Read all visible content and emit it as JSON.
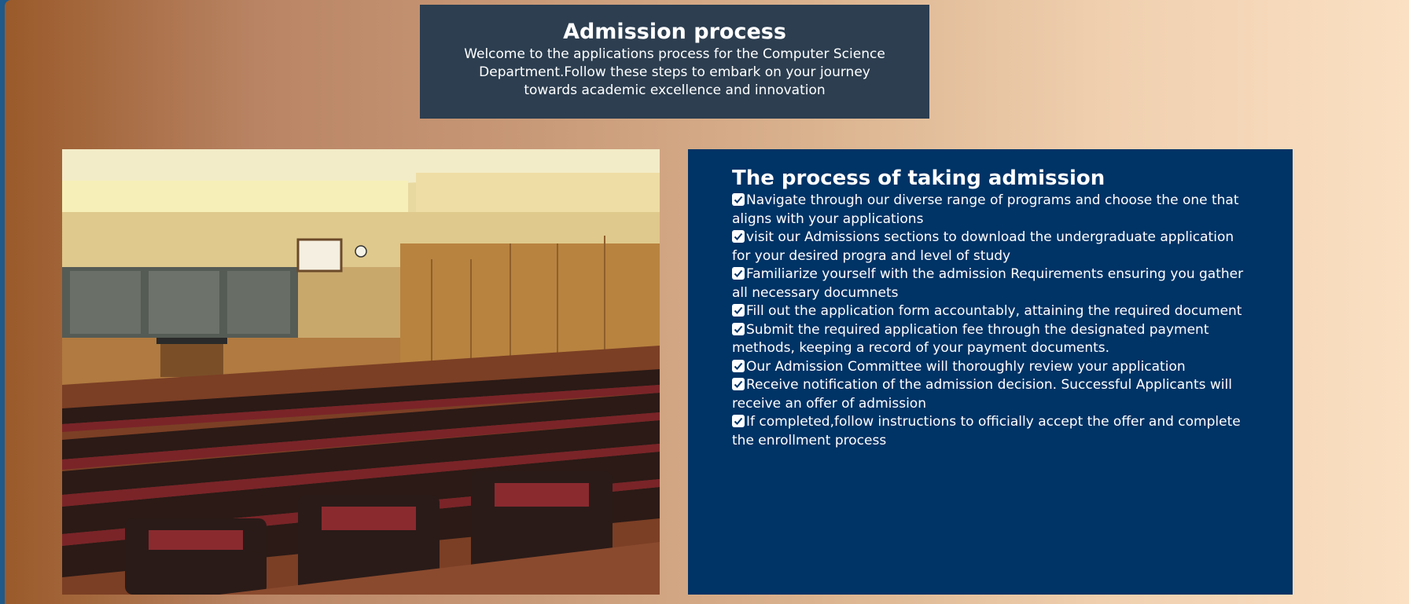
{
  "header": {
    "title": "Admission process",
    "intro": "Welcome to the applications process for the Computer Science Department.Follow these steps to embark on your journey towards academic excellence and innovation"
  },
  "image": {
    "subject": "lecture hall with rows of red theater seats and chalkboards",
    "icon": "lecture-hall-photo"
  },
  "process": {
    "title": "The process of taking admission",
    "check_icon": "checkbox-checked-icon",
    "steps": [
      "Navigate through our diverse range of programs and choose the one that aligns with your applications",
      "visit our Admissions sections to download the undergraduate application for your desired progra and level of study",
      "Familiarize yourself with the admission Requirements ensuring you gather all necessary documnets",
      "Fill out the application form accountably, attaining the required document",
      "Submit the required application fee through the designated payment methods, keeping a record of your payment documents.",
      "Our Admission Committee will thoroughly review your application",
      "Receive notification of the admission decision. Successful Applicants will receive an offer of admission",
      "If completed,follow instructions to officially accept the offer and complete the enrollment process"
    ]
  },
  "colors": {
    "header_bg": "#2c3e50",
    "process_bg": "#003366",
    "text": "#ffffff",
    "gradient_left": "#9a5a2a",
    "gradient_right": "#fbe0c3"
  }
}
